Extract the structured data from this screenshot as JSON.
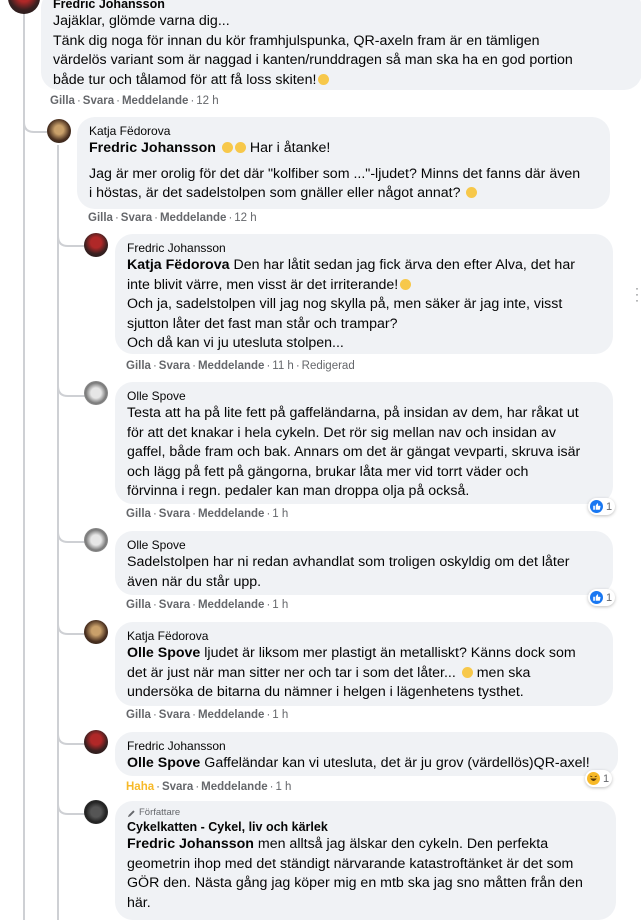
{
  "comments": [
    {
      "author": "Fredric Johansson",
      "lines": [
        "Jajäklar, glömde varna dig...",
        "Tänk dig noga för innan du kör framhjulspunka, QR-axeln fram är en tämligen",
        "värdelös variant som är naggad i kanten/runddragen så man ska ha en god portion",
        "både tur och tålamod för att få loss skiten!"
      ],
      "actions": {
        "like": "Gilla",
        "reply": "Svara",
        "message": "Meddelande",
        "time": "12 h"
      }
    },
    {
      "author": "Katja Fëdorova",
      "mention": "Fredric Johansson",
      "lines_first": "Har i åtanke!",
      "lines": [
        "Jag är mer orolig för det där \"kolfiber som ...\"-ljudet? Minns det fanns där även",
        "i höstas, är det sadelstolpen som gnäller eller något annat?"
      ],
      "actions": {
        "like": "Gilla",
        "reply": "Svara",
        "message": "Meddelande",
        "time": "12 h"
      }
    },
    {
      "author": "Fredric Johansson",
      "mention": "Katja Fëdorova",
      "lines_first": "Den har låtit sedan jag fick ärva den efter Alva, det har",
      "lines": [
        "inte blivit värre, men visst är det irriterande!",
        "Och ja, sadelstolpen vill jag nog skylla på, men säker är jag inte, visst",
        "sjutton låter det fast man står och trampar?",
        "Och då kan vi ju utesluta stolpen..."
      ],
      "actions": {
        "like": "Gilla",
        "reply": "Svara",
        "message": "Meddelande",
        "time": "11 h",
        "edited": "Redigerad"
      }
    },
    {
      "author": "Olle Spove",
      "lines": [
        "Testa att ha på lite fett på gaffeländarna, på insidan av dem, har råkat ut",
        "för att det knakar i hela cykeln. Det rör sig mellan nav och insidan av",
        "gaffel, både fram och bak. Annars om det är gängat vevparti, skruva isär",
        "och lägg på fett på gängorna, brukar låta mer vid torrt väder och",
        "förvinna i regn. pedaler kan man droppa olja på också."
      ],
      "actions": {
        "like": "Gilla",
        "reply": "Svara",
        "message": "Meddelande",
        "time": "1 h"
      },
      "reaction_count": "1"
    },
    {
      "author": "Olle Spove",
      "lines": [
        "Sadelstolpen har ni redan avhandlat som troligen oskyldig om det låter",
        "även när du står upp."
      ],
      "actions": {
        "like": "Gilla",
        "reply": "Svara",
        "message": "Meddelande",
        "time": "1 h"
      },
      "reaction_count": "1"
    },
    {
      "author": "Katja Fëdorova",
      "mention": "Olle Spove",
      "lines_first": "ljudet är liksom mer plastigt än metalliskt? Känns dock som",
      "lines": [
        "det är just när man sitter ner och tar i som det låter...",
        "undersöka de bitarna du nämner i helgen i lägenhetens tysthet."
      ],
      "line2_tail": "men ska",
      "actions": {
        "like": "Gilla",
        "reply": "Svara",
        "message": "Meddelande",
        "time": "1 h"
      }
    },
    {
      "author": "Fredric Johansson",
      "mention": "Olle Spove",
      "lines_first": "Gaffeländar kan vi utesluta, det är ju grov (värdellös)QR-axel!",
      "actions": {
        "like": "Haha",
        "reply": "Svara",
        "message": "Meddelande",
        "time": "1 h"
      },
      "reaction_count": "1"
    },
    {
      "badge": "Författare",
      "author": "Cykelkatten - Cykel, liv och kärlek",
      "mention": "Fredric Johansson",
      "lines_first": "men alltså jag älskar den cykeln. Den perfekta",
      "lines": [
        "geometrin ihop med det ständigt närvarande katastroftänket är det som",
        "GÖR den. Nästa gång jag köper mig en mtb ska jag sno måtten från den",
        "här."
      ]
    }
  ],
  "colors": {
    "bubble": "#f0f2f5",
    "meta": "#65676b",
    "like_blue": "#1877f2",
    "haha_yellow": "#f7b928",
    "thread": "#ced0d4"
  }
}
